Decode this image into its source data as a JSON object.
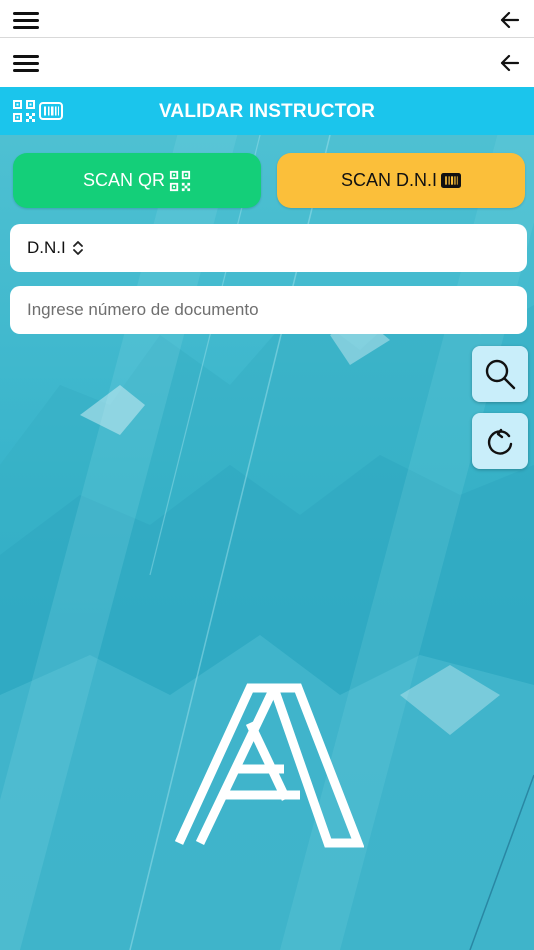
{
  "header": {
    "title": "VALIDAR INSTRUCTOR"
  },
  "scan_qr": {
    "label": "SCAN QR"
  },
  "scan_dni": {
    "label": "SCAN D.N.I"
  },
  "document_type": {
    "selected": "D.N.I"
  },
  "document_input": {
    "placeholder": "Ingrese número de documento",
    "value": ""
  },
  "colors": {
    "titlebar": "#1bc5ec",
    "qr_button": "#14cf79",
    "dni_button": "#fbbf3a",
    "side_button": "#c9eefa"
  },
  "icons": [
    "menu-icon",
    "back-arrow-icon",
    "qr-code-icon",
    "barcode-icon",
    "chevron-updown-icon",
    "search-icon",
    "refresh-icon",
    "logo-a-icon"
  ]
}
